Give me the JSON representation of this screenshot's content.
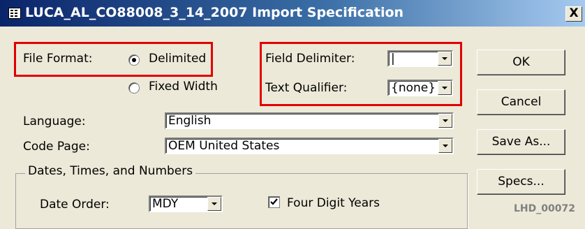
{
  "window": {
    "title": "LUCA_AL_CO88008_3_14_2007 Import Specification",
    "title_icon": "table-icon",
    "close_label": "X"
  },
  "file_format": {
    "label": "File Format:",
    "options": [
      {
        "label": "Delimited",
        "selected": true
      },
      {
        "label": "Fixed Width",
        "selected": false
      }
    ]
  },
  "field_delimiter": {
    "label": "Field Delimiter:",
    "value": "|"
  },
  "text_qualifier": {
    "label": "Text Qualifier:",
    "value": "{none}"
  },
  "language": {
    "label": "Language:",
    "value": "English"
  },
  "code_page": {
    "label": "Code Page:",
    "value": "OEM United States"
  },
  "dates_group": {
    "label": "Dates, Times, and Numbers",
    "date_order": {
      "label": "Date Order:",
      "value": "MDY"
    },
    "four_digit_years": {
      "label": "Four Digit Years",
      "checked": true
    }
  },
  "buttons": {
    "ok": "OK",
    "cancel": "Cancel",
    "save_as": "Save As...",
    "specs": "Specs..."
  },
  "watermark": "LHD_00072",
  "colors": {
    "highlight": "#e00000",
    "title_start": "#0a246a",
    "title_end": "#a6caf0",
    "dialog_bg": "#ece9d8"
  }
}
